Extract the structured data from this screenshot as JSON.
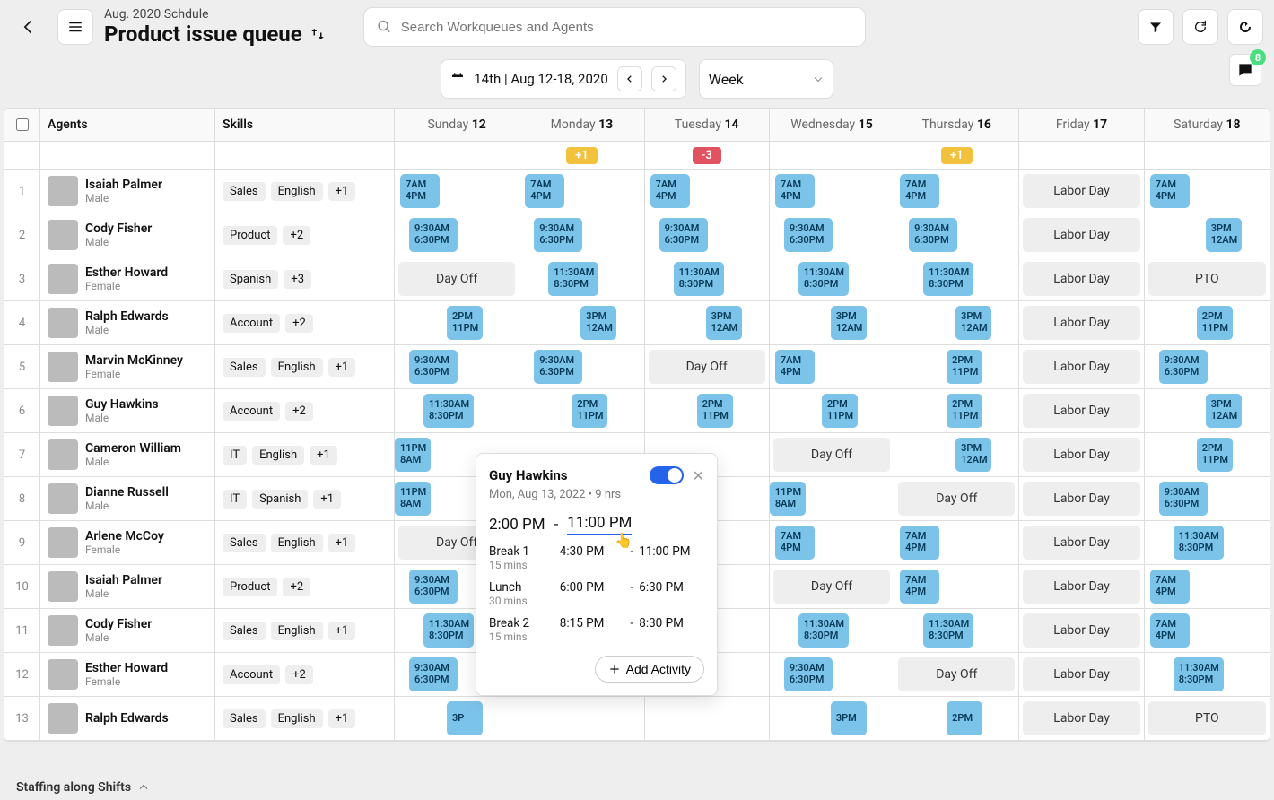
{
  "header": {
    "subtitle": "Aug. 2020 Schdule",
    "title": "Product issue queue",
    "search_placeholder": "Search Workqueues and Agents"
  },
  "controls": {
    "date_label": "14th  |  Aug 12-18, 2020",
    "view_label": "Week",
    "chat_count": "8"
  },
  "columns": {
    "agents": "Agents",
    "skills": "Skills"
  },
  "days": [
    {
      "name": "Sunday",
      "num": "12",
      "variance": ""
    },
    {
      "name": "Monday",
      "num": "13",
      "variance": "+1",
      "vclass": "plus"
    },
    {
      "name": "Tuesday",
      "num": "14",
      "variance": "-3",
      "vclass": "minus"
    },
    {
      "name": "Wednesday",
      "num": "15",
      "variance": ""
    },
    {
      "name": "Thursday",
      "num": "16",
      "variance": "+1",
      "vclass": "plus"
    },
    {
      "name": "Friday",
      "num": "17",
      "variance": ""
    },
    {
      "name": "Saturday",
      "num": "18",
      "variance": ""
    }
  ],
  "agents": [
    {
      "n": "1",
      "name": "Isaiah Palmer",
      "sub": "Male",
      "skills": [
        "Sales",
        "English",
        "+1"
      ],
      "cells": [
        {
          "t": "shift",
          "l1": "7AM",
          "l2": "4PM",
          "cls": "s-early"
        },
        {
          "t": "shift",
          "l1": "7AM",
          "l2": "4PM",
          "cls": "s-early"
        },
        {
          "t": "shift",
          "l1": "7AM",
          "l2": "4PM",
          "cls": "s-early"
        },
        {
          "t": "shift",
          "l1": "7AM",
          "l2": "4PM",
          "cls": "s-early"
        },
        {
          "t": "shift",
          "l1": "7AM",
          "l2": "4PM",
          "cls": "s-early"
        },
        {
          "t": "holiday",
          "label": "Labor Day"
        },
        {
          "t": "shift",
          "l1": "7AM",
          "l2": "4PM",
          "cls": "s-early"
        }
      ]
    },
    {
      "n": "2",
      "name": "Cody Fisher",
      "sub": "Male",
      "skills": [
        "Product",
        "+2"
      ],
      "cells": [
        {
          "t": "shift",
          "l1": "9:30AM",
          "l2": "6:30PM",
          "cls": "s-930"
        },
        {
          "t": "shift",
          "l1": "9:30AM",
          "l2": "6:30PM",
          "cls": "s-930"
        },
        {
          "t": "shift",
          "l1": "9:30AM",
          "l2": "6:30PM",
          "cls": "s-930"
        },
        {
          "t": "shift",
          "l1": "9:30AM",
          "l2": "6:30PM",
          "cls": "s-930"
        },
        {
          "t": "shift",
          "l1": "9:30AM",
          "l2": "6:30PM",
          "cls": "s-930"
        },
        {
          "t": "holiday",
          "label": "Labor Day"
        },
        {
          "t": "shift",
          "l1": "3PM",
          "l2": "12AM",
          "cls": "s-3pm"
        }
      ]
    },
    {
      "n": "3",
      "name": "Esther Howard",
      "sub": "Female",
      "skills": [
        "Spanish",
        "+3"
      ],
      "cells": [
        {
          "t": "dayoff",
          "label": "Day Off"
        },
        {
          "t": "shift",
          "l1": "11:30AM",
          "l2": "8:30PM",
          "cls": "s-1130"
        },
        {
          "t": "shift",
          "l1": "11:30AM",
          "l2": "8:30PM",
          "cls": "s-1130"
        },
        {
          "t": "shift",
          "l1": "11:30AM",
          "l2": "8:30PM",
          "cls": "s-1130"
        },
        {
          "t": "shift",
          "l1": "11:30AM",
          "l2": "8:30PM",
          "cls": "s-1130"
        },
        {
          "t": "holiday",
          "label": "Labor Day"
        },
        {
          "t": "holiday",
          "label": "PTO"
        }
      ]
    },
    {
      "n": "4",
      "name": "Ralph Edwards",
      "sub": "Male",
      "skills": [
        "Account",
        "+2"
      ],
      "cells": [
        {
          "t": "shift",
          "l1": "2PM",
          "l2": "11PM",
          "cls": "s-2pm"
        },
        {
          "t": "shift",
          "l1": "3PM",
          "l2": "12AM",
          "cls": "s-3pm"
        },
        {
          "t": "shift",
          "l1": "3PM",
          "l2": "12AM",
          "cls": "s-3pm"
        },
        {
          "t": "shift",
          "l1": "3PM",
          "l2": "12AM",
          "cls": "s-3pm"
        },
        {
          "t": "shift",
          "l1": "3PM",
          "l2": "12AM",
          "cls": "s-3pm"
        },
        {
          "t": "holiday",
          "label": "Labor Day"
        },
        {
          "t": "shift",
          "l1": "2PM",
          "l2": "11PM",
          "cls": "s-2pm"
        }
      ]
    },
    {
      "n": "5",
      "name": "Marvin McKinney",
      "sub": "Female",
      "skills": [
        "Sales",
        "English",
        "+1"
      ],
      "cells": [
        {
          "t": "shift",
          "l1": "9:30AM",
          "l2": "6:30PM",
          "cls": "s-930"
        },
        {
          "t": "shift",
          "l1": "9:30AM",
          "l2": "6:30PM",
          "cls": "s-930"
        },
        {
          "t": "dayoff",
          "label": "Day Off"
        },
        {
          "t": "shift",
          "l1": "7AM",
          "l2": "4PM",
          "cls": "s-early"
        },
        {
          "t": "shift",
          "l1": "2PM",
          "l2": "11PM",
          "cls": "s-2pm"
        },
        {
          "t": "holiday",
          "label": "Labor Day"
        },
        {
          "t": "shift",
          "l1": "9:30AM",
          "l2": "6:30PM",
          "cls": "s-930"
        }
      ]
    },
    {
      "n": "6",
      "name": "Guy Hawkins",
      "sub": "Male",
      "skills": [
        "Account",
        "+2"
      ],
      "cells": [
        {
          "t": "shift",
          "l1": "11:30AM",
          "l2": "8:30PM",
          "cls": "s-1130"
        },
        {
          "t": "shift",
          "l1": "2PM",
          "l2": "11PM",
          "cls": "s-2pm"
        },
        {
          "t": "shift",
          "l1": "2PM",
          "l2": "11PM",
          "cls": "s-2pm"
        },
        {
          "t": "shift",
          "l1": "2PM",
          "l2": "11PM",
          "cls": "s-2pm"
        },
        {
          "t": "shift",
          "l1": "2PM",
          "l2": "11PM",
          "cls": "s-2pm"
        },
        {
          "t": "holiday",
          "label": "Labor Day"
        },
        {
          "t": "shift",
          "l1": "3PM",
          "l2": "12AM",
          "cls": "s-3pm"
        }
      ]
    },
    {
      "n": "7",
      "name": "Cameron William",
      "sub": "Male",
      "skills": [
        "IT",
        "English",
        "+1"
      ],
      "cells": [
        {
          "t": "shift",
          "l1": "11PM",
          "l2": "8AM",
          "cls": "s-11pm"
        },
        {
          "t": "empty"
        },
        {
          "t": "empty"
        },
        {
          "t": "dayoff",
          "label": "Day Off"
        },
        {
          "t": "shift",
          "l1": "3PM",
          "l2": "12AM",
          "cls": "s-3pm"
        },
        {
          "t": "holiday",
          "label": "Labor Day"
        },
        {
          "t": "shift",
          "l1": "2PM",
          "l2": "11PM",
          "cls": "s-2pm"
        }
      ]
    },
    {
      "n": "8",
      "name": "Dianne Russell",
      "sub": "Male",
      "skills": [
        "IT",
        "Spanish",
        "+1"
      ],
      "cells": [
        {
          "t": "shift",
          "l1": "11PM",
          "l2": "8AM",
          "cls": "s-11pm"
        },
        {
          "t": "empty"
        },
        {
          "t": "empty"
        },
        {
          "t": "shift",
          "l1": "11PM",
          "l2": "8AM",
          "cls": "s-11pm"
        },
        {
          "t": "dayoff",
          "label": "Day Off"
        },
        {
          "t": "holiday",
          "label": "Labor Day"
        },
        {
          "t": "shift",
          "l1": "9:30AM",
          "l2": "6:30PM",
          "cls": "s-930"
        }
      ]
    },
    {
      "n": "9",
      "name": "Arlene McCoy",
      "sub": "Female",
      "skills": [
        "Sales",
        "English",
        "+1"
      ],
      "cells": [
        {
          "t": "dayoff",
          "label": "Day Off"
        },
        {
          "t": "empty"
        },
        {
          "t": "empty"
        },
        {
          "t": "shift",
          "l1": "7AM",
          "l2": "4PM",
          "cls": "s-early"
        },
        {
          "t": "shift",
          "l1": "7AM",
          "l2": "4PM",
          "cls": "s-early"
        },
        {
          "t": "holiday",
          "label": "Labor Day"
        },
        {
          "t": "shift",
          "l1": "11:30AM",
          "l2": "8:30PM",
          "cls": "s-1130"
        }
      ]
    },
    {
      "n": "10",
      "name": "Isaiah Palmer",
      "sub": "Male",
      "skills": [
        "Product",
        "+2"
      ],
      "cells": [
        {
          "t": "shift",
          "l1": "9:30AM",
          "l2": "6:30PM",
          "cls": "s-930"
        },
        {
          "t": "empty"
        },
        {
          "t": "empty"
        },
        {
          "t": "dayoff",
          "label": "Day Off"
        },
        {
          "t": "shift",
          "l1": "7AM",
          "l2": "4PM",
          "cls": "s-early"
        },
        {
          "t": "holiday",
          "label": "Labor Day"
        },
        {
          "t": "shift",
          "l1": "7AM",
          "l2": "4PM",
          "cls": "s-early"
        }
      ]
    },
    {
      "n": "11",
      "name": "Cody Fisher",
      "sub": "Male",
      "skills": [
        "Sales",
        "English",
        "+1"
      ],
      "cells": [
        {
          "t": "shift",
          "l1": "11:30AM",
          "l2": "8:30PM",
          "cls": "s-1130"
        },
        {
          "t": "empty"
        },
        {
          "t": "empty"
        },
        {
          "t": "shift",
          "l1": "11:30AM",
          "l2": "8:30PM",
          "cls": "s-1130"
        },
        {
          "t": "shift",
          "l1": "11:30AM",
          "l2": "8:30PM",
          "cls": "s-1130"
        },
        {
          "t": "holiday",
          "label": "Labor Day"
        },
        {
          "t": "shift",
          "l1": "7AM",
          "l2": "4PM",
          "cls": "s-early"
        }
      ]
    },
    {
      "n": "12",
      "name": "Esther Howard",
      "sub": "Female",
      "skills": [
        "Account",
        "+2"
      ],
      "cells": [
        {
          "t": "shift",
          "l1": "9:30AM",
          "l2": "6:30PM",
          "cls": "s-930"
        },
        {
          "t": "empty"
        },
        {
          "t": "empty"
        },
        {
          "t": "shift",
          "l1": "9:30AM",
          "l2": "6:30PM",
          "cls": "s-930"
        },
        {
          "t": "dayoff",
          "label": "Day Off"
        },
        {
          "t": "holiday",
          "label": "Labor Day"
        },
        {
          "t": "shift",
          "l1": "11:30AM",
          "l2": "8:30PM",
          "cls": "s-1130"
        }
      ]
    },
    {
      "n": "13",
      "name": "Ralph Edwards",
      "sub": "",
      "skills": [
        "Sales",
        "English",
        "+1"
      ],
      "cells": [
        {
          "t": "shift",
          "l1": "3P",
          "l2": "",
          "cls": "s-2pm"
        },
        {
          "t": "empty"
        },
        {
          "t": "empty"
        },
        {
          "t": "shift",
          "l1": "3PM",
          "l2": "",
          "cls": "s-3pm"
        },
        {
          "t": "shift",
          "l1": "2PM",
          "l2": "",
          "cls": "s-2pm"
        },
        {
          "t": "holiday",
          "label": "Labor Day"
        },
        {
          "t": "holiday",
          "label": "PTO"
        }
      ]
    }
  ],
  "popover": {
    "name": "Guy Hawkins",
    "sub": "Mon, Aug 13, 2022 • 9 hrs",
    "start": "2:00 PM",
    "dash": "-",
    "end": "11:00 PM",
    "breaks": [
      {
        "label": "Break 1",
        "mins": "15 mins",
        "from": "4:30 PM",
        "to": "11:00 PM"
      },
      {
        "label": "Lunch",
        "mins": "30 mins",
        "from": "6:00 PM",
        "to": "6:30 PM"
      },
      {
        "label": "Break 2",
        "mins": "15 mins",
        "from": "8:15 PM",
        "to": "8:30 PM"
      }
    ],
    "add_label": "Add Activity"
  },
  "footer": {
    "label": "Staffing along Shifts"
  }
}
